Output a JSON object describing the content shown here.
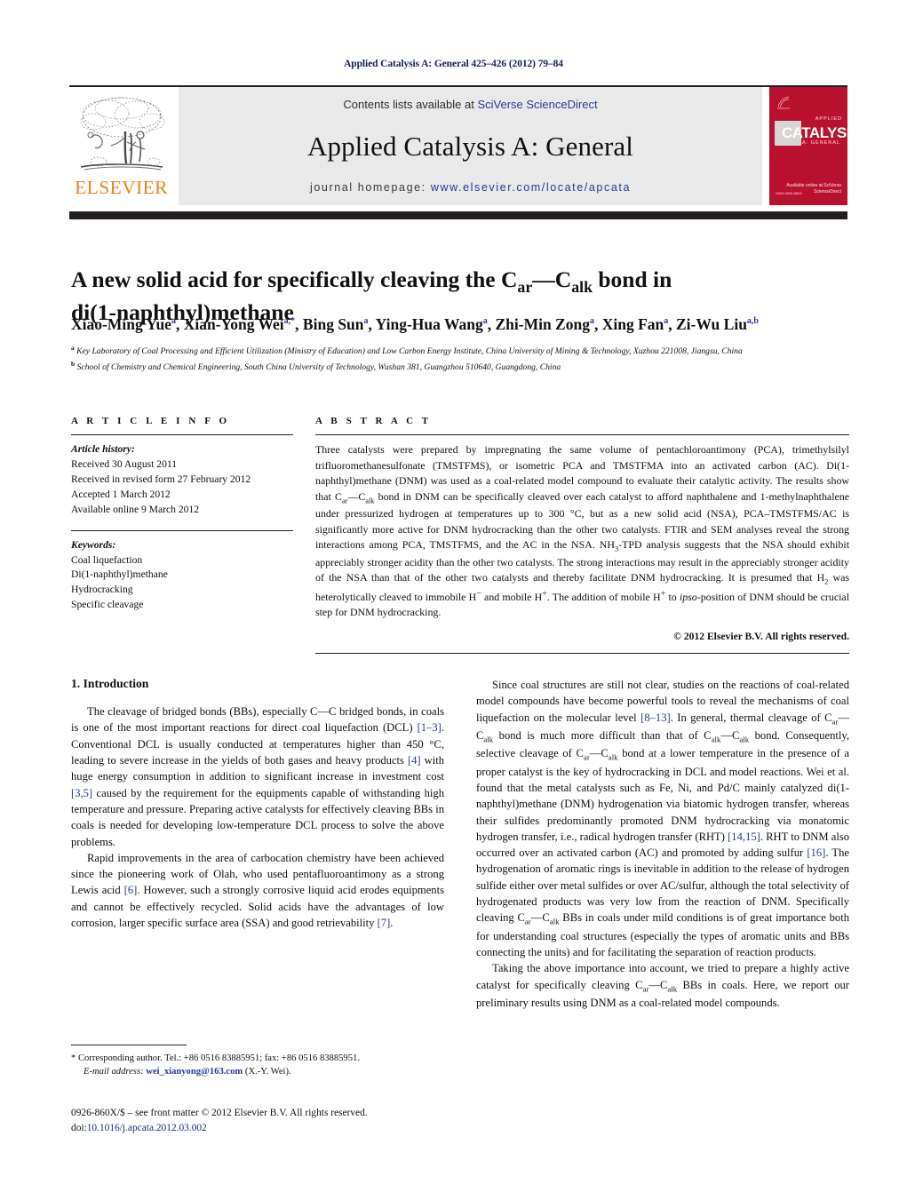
{
  "running_head": "Applied Catalysis A: General 425–426 (2012) 79–84",
  "masthead": {
    "contents_prefix": "Contents lists available at ",
    "sciencedirect": "SciVerse ScienceDirect",
    "journal_title": "Applied Catalysis A: General",
    "homepage_prefix": "journal homepage: ",
    "homepage_url": "www.elsevier.com/locate/apcata",
    "publisher": "ELSEVIER",
    "cover": {
      "main_word": "CATALYSIS",
      "top_label": "APPLIED",
      "sub_label": "A: GENERAL",
      "sciencedirect_mark": "Available online at\nSciVerse ScienceDirect",
      "issn_mark": "ISSN 0926-860X"
    },
    "colors": {
      "link": "#2a3a94",
      "elsevier_orange": "#f07f1a",
      "cover_red": "#b8122e",
      "band_gray": "#e9e9e9",
      "bar_black": "#231f20"
    }
  },
  "article": {
    "title_line1_a": "A new solid acid for specifically cleaving the C",
    "title_sub1": "ar",
    "title_dash": "—C",
    "title_sub2": "alk",
    "title_line1_b": " bond in",
    "title_line2": "di(1-naphthyl)methane",
    "authors": [
      {
        "name": "Xiao-Ming Yue",
        "sup": "a"
      },
      {
        "name": "Xian-Yong Wei",
        "sup": "a,*"
      },
      {
        "name": "Bing Sun",
        "sup": "a"
      },
      {
        "name": "Ying-Hua Wang",
        "sup": "a"
      },
      {
        "name": "Zhi-Min Zong",
        "sup": "a"
      },
      {
        "name": "Xing Fan",
        "sup": "a"
      },
      {
        "name": "Zi-Wu Liu",
        "sup": "a,b"
      }
    ],
    "affiliations": [
      {
        "mark": "a",
        "text": "Key Laboratory of Coal Processing and Efficient Utilization (Ministry of Education) and Low Carbon Energy Institute, China University of Mining & Technology, Xuzhou 221008, Jiangsu, China"
      },
      {
        "mark": "b",
        "text": "School of Chemistry and Chemical Engineering, South China University of Technology, Wushan 381, Guangzhou 510640, Guangdong, China"
      }
    ]
  },
  "article_info": {
    "heading": "A R T I C L E   I N F O",
    "history_label": "Article history:",
    "history": [
      "Received 30 August 2011",
      "Received in revised form 27 February 2012",
      "Accepted 1 March 2012",
      "Available online 9 March 2012"
    ],
    "keywords_label": "Keywords:",
    "keywords": [
      "Coal liquefaction",
      "Di(1-naphthyl)methane",
      "Hydrocracking",
      "Specific cleavage"
    ]
  },
  "abstract": {
    "heading": "A B S T R A C T",
    "p1_a": "Three catalysts were prepared by impregnating the same volume of pentachloroantimony (PCA), trimethylsilyl trifluoromethanesulfonate (TMSTFMS), or isometric PCA and TMSTFMA into an activated carbon (AC). Di(1-naphthyl)methane (DNM) was used as a coal-related model compound to evaluate their catalytic activity. The results show that C",
    "sub1": "ar",
    "p1_b": "—C",
    "sub2": "alk",
    "p1_c": " bond in DNM can be specifically cleaved over each catalyst to afford naphthalene and 1-methylnaphthalene under pressurized hydrogen at temperatures up to 300 °C, but as a new solid acid (NSA), PCA–TMSTFMS/AC is significantly more active for DNM hydrocracking than the other two catalysts. FTIR and SEM analyses reveal the strong interactions among PCA, TMSTFMS, and the AC in the NSA. NH",
    "sub3": "3",
    "p1_d": "-TPD analysis suggests that the NSA should exhibit appreciably stronger acidity than the other two catalysts. The strong interactions may result in the appreciably stronger acidity of the NSA than that of the other two catalysts and thereby facilitate DNM hydrocracking. It is presumed that H",
    "sub4": "2",
    "p1_e": " was heterolytically cleaved to immobile H",
    "sup1": "−",
    "p1_f": " and mobile H",
    "sup2": "+",
    "p1_g": ". The addition of mobile H",
    "sup3": "+",
    "p1_h": " to ",
    "italic1": "ipso",
    "p1_i": "-position of DNM should be crucial step for DNM hydrocracking.",
    "copyright": "© 2012 Elsevier B.V. All rights reserved."
  },
  "introduction": {
    "heading": "1. Introduction",
    "left_paragraphs": [
      {
        "parts": [
          {
            "t": "The cleavage of bridged bonds (BBs), especially C—C bridged bonds, in coals is one of the most important reactions for direct coal liquefaction (DCL) "
          },
          {
            "t": "[1–3]",
            "ref": true
          },
          {
            "t": ". Conventional DCL is usually conducted at temperatures higher than 450 °C, leading to severe increase in the yields of both gases and heavy products "
          },
          {
            "t": "[4]",
            "ref": true
          },
          {
            "t": " with huge energy consumption in addition to significant increase in investment cost "
          },
          {
            "t": "[3,5]",
            "ref": true
          },
          {
            "t": " caused by the requirement for the equipments capable of withstanding high temperature and pressure. Preparing active catalysts for effectively cleaving BBs in coals is needed for developing low-temperature DCL process to solve the above problems."
          }
        ]
      },
      {
        "parts": [
          {
            "t": "Rapid improvements in the area of carbocation chemistry have been achieved since the pioneering work of Olah, who used pentafluoroantimony as a strong Lewis acid "
          },
          {
            "t": "[6]",
            "ref": true
          },
          {
            "t": ". However, such a strongly corrosive liquid acid erodes equipments and cannot be effectively recycled. Solid acids have the advantages of low corrosion, larger specific surface area (SSA) and good retrievability "
          },
          {
            "t": "[7]",
            "ref": true
          },
          {
            "t": "."
          }
        ]
      }
    ],
    "right_paragraphs": [
      {
        "parts": [
          {
            "t": "Since coal structures are still not clear, studies on the reactions of coal-related model compounds have become powerful tools to reveal the mechanisms of coal liquefaction on the molecular level "
          },
          {
            "t": "[8–13]",
            "ref": true
          },
          {
            "t": ". In general, thermal cleavage of C"
          },
          {
            "t": "ar",
            "sub": true
          },
          {
            "t": "—C"
          },
          {
            "t": "alk",
            "sub": true
          },
          {
            "t": " bond is much more difficult than that of C"
          },
          {
            "t": "alk",
            "sub": true
          },
          {
            "t": "—C"
          },
          {
            "t": "alk",
            "sub": true
          },
          {
            "t": " bond. Consequently, selective cleavage of C"
          },
          {
            "t": "ar",
            "sub": true
          },
          {
            "t": "—C"
          },
          {
            "t": "alk",
            "sub": true
          },
          {
            "t": " bond at a lower temperature in the presence of a proper catalyst is the key of hydrocracking in DCL and model reactions. Wei et al. found that the metal catalysts such as Fe, Ni, and Pd/C mainly catalyzed di(1-naphthyl)methane (DNM) hydrogenation via biatomic hydrogen transfer, whereas their sulfides predominantly promoted DNM hydrocracking via monatomic hydrogen transfer, i.e., radical hydrogen transfer (RHT) "
          },
          {
            "t": "[14,15]",
            "ref": true
          },
          {
            "t": ". RHT to DNM also occurred over an activated carbon (AC) and promoted by adding sulfur "
          },
          {
            "t": "[16]",
            "ref": true
          },
          {
            "t": ". The hydrogenation of aromatic rings is inevitable in addition to the release of hydrogen sulfide either over metal sulfides or over AC/sulfur, although the total selectivity of hydrogenated products was very low from the reaction of DNM. Specifically cleaving C"
          },
          {
            "t": "ar",
            "sub": true
          },
          {
            "t": "—C"
          },
          {
            "t": "alk",
            "sub": true
          },
          {
            "t": " BBs in coals under mild conditions is of great importance both for understanding coal structures (especially the types of aromatic units and BBs connecting the units) and for facilitating the separation of reaction products."
          }
        ]
      },
      {
        "parts": [
          {
            "t": "Taking the above importance into account, we tried to prepare a highly active catalyst for specifically cleaving C"
          },
          {
            "t": "ar",
            "sub": true
          },
          {
            "t": "—C"
          },
          {
            "t": "alk",
            "sub": true
          },
          {
            "t": " BBs in coals. Here, we report our preliminary results using DNM as a coal-related model compounds."
          }
        ]
      }
    ]
  },
  "footnotes": {
    "corresponding": "* Corresponding author. Tel.: +86 0516 83885951; fax: +86 0516 83885951.",
    "email_label": "E-mail address:",
    "email": "wei_xianyong@163.com",
    "email_suffix": "(X.-Y. Wei)."
  },
  "imprint": {
    "line1": "0926-860X/$ – see front matter © 2012 Elsevier B.V. All rights reserved.",
    "doi_label": "doi:",
    "doi": "10.1016/j.apcata.2012.03.002"
  }
}
